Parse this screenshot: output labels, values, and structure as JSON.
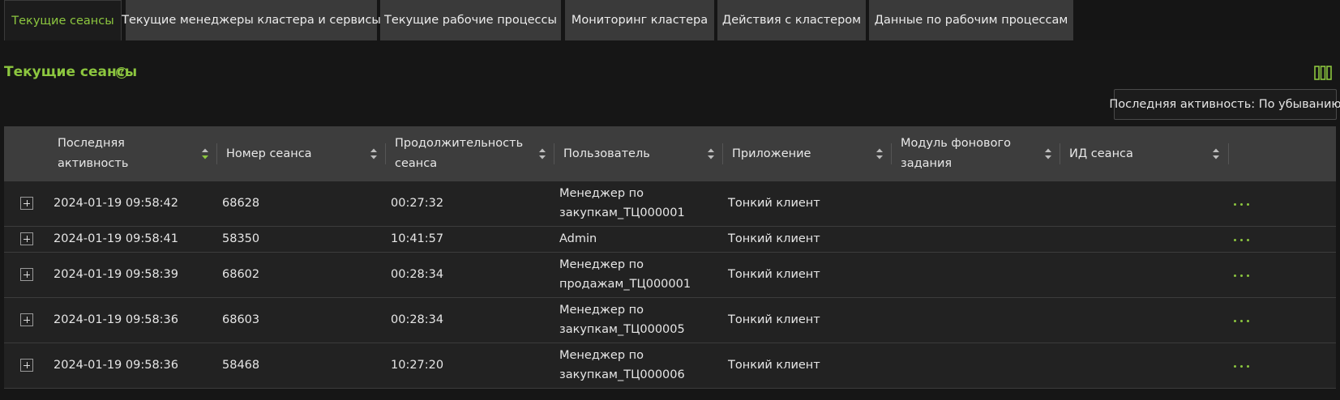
{
  "tabs": [
    {
      "label": "Текущие сеансы",
      "active": true
    },
    {
      "label": "Текущие менеджеры кластера и сервисы",
      "active": false
    },
    {
      "label": "Текущие рабочие процессы",
      "active": false
    },
    {
      "label": "Мониторинг кластера",
      "active": false
    },
    {
      "label": "Действия с кластером",
      "active": false
    },
    {
      "label": "Данные по рабочим процессам",
      "active": false
    }
  ],
  "section": {
    "title": "Текущие сеансы",
    "help_icon": "question-circle-icon",
    "columns_icon": "columns-icon"
  },
  "sort_indicator": "Последняя активность: По убыванию",
  "table": {
    "columns": [
      {
        "label": "Последняя активность",
        "sort": "desc"
      },
      {
        "label": "Номер сеанса",
        "sort": "none"
      },
      {
        "label": "Продолжительность сеанса",
        "sort": "none"
      },
      {
        "label": "Пользователь",
        "sort": "none"
      },
      {
        "label": "Приложение",
        "sort": "none"
      },
      {
        "label": "Модуль фонового задания",
        "sort": "none"
      },
      {
        "label": "ИД сеанса",
        "sort": "none"
      }
    ],
    "rows": [
      {
        "last_activity": "2024-01-19 09:58:42",
        "session_number": "68628",
        "duration": "00:27:32",
        "user": "Менеджер по закупкам_ТЦ000001",
        "user_line1": "Менеджер по",
        "user_line2": "закупкам_ТЦ000001",
        "application": "Тонкий клиент",
        "bg_module": "",
        "session_id": ""
      },
      {
        "last_activity": "2024-01-19 09:58:41",
        "session_number": "58350",
        "duration": "10:41:57",
        "user": "Admin",
        "user_line1": "Admin",
        "user_line2": "",
        "application": "Тонкий клиент",
        "bg_module": "",
        "session_id": ""
      },
      {
        "last_activity": "2024-01-19 09:58:39",
        "session_number": "68602",
        "duration": "00:28:34",
        "user": "Менеджер по продажам_ТЦ000001",
        "user_line1": "Менеджер по",
        "user_line2": "продажам_ТЦ000001",
        "application": "Тонкий клиент",
        "bg_module": "",
        "session_id": ""
      },
      {
        "last_activity": "2024-01-19 09:58:36",
        "session_number": "68603",
        "duration": "00:28:34",
        "user": "Менеджер по закупкам_ТЦ000005",
        "user_line1": "Менеджер по",
        "user_line2": "закупкам_ТЦ000005",
        "application": "Тонкий клиент",
        "bg_module": "",
        "session_id": ""
      },
      {
        "last_activity": "2024-01-19 09:58:36",
        "session_number": "58468",
        "duration": "10:27:20",
        "user": "Менеджер по закупкам_ТЦ000006",
        "user_line1": "Менеджер по",
        "user_line2": "закупкам_ТЦ000006",
        "application": "Тонкий клиент",
        "bg_module": "",
        "session_id": ""
      }
    ]
  },
  "colors": {
    "accent": "#8cc63f",
    "background": "#161616",
    "header_bg": "#3d3d3d",
    "row_bg": "#222222",
    "tab_bg": "#3a3a3a"
  }
}
